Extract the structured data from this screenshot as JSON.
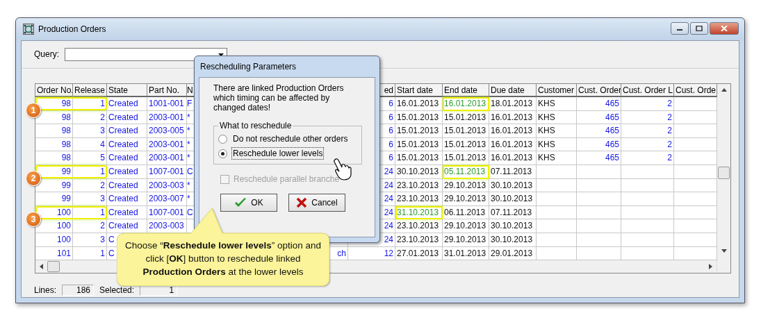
{
  "window": {
    "title": "Production Orders"
  },
  "query": {
    "label": "Query:"
  },
  "table": {
    "columns": [
      {
        "label": "Order No."
      },
      {
        "label": "Release"
      },
      {
        "label": "State"
      },
      {
        "label": "Part No."
      },
      {
        "label": "N"
      },
      {},
      {
        "label": "ed"
      },
      {
        "label": "Start date"
      },
      {
        "label": "End date"
      },
      {
        "label": "Due date"
      },
      {
        "label": "Customer"
      },
      {
        "label": "Cust. Order"
      },
      {
        "label": "Cust. Order L"
      },
      {
        "label": "Cust. Orde"
      }
    ],
    "rows": [
      {
        "step": "1",
        "cells": [
          {
            "text": "98",
            "highlighted": false
          },
          {
            "text": "1",
            "highlighted": false
          },
          {
            "text": "Created",
            "highlighted": false
          },
          {
            "text": "1001-001",
            "highlighted": false
          },
          {
            "text": "F",
            "highlighted": false
          },
          null,
          {
            "text": "6",
            "highlighted": false
          },
          {
            "text": "16.01.2013",
            "highlighted": false
          },
          {
            "text": "16.01.2013",
            "highlighted": true
          },
          {
            "text": "18.01.2013",
            "highlighted": false
          },
          {
            "text": "KHS",
            "highlighted": false
          },
          {
            "text": "465",
            "highlighted": false
          },
          {
            "text": "2",
            "highlighted": false
          },
          null
        ]
      },
      {
        "cells": [
          {
            "text": "98",
            "highlighted": false
          },
          {
            "text": "2",
            "highlighted": false
          },
          {
            "text": "Created",
            "highlighted": false
          },
          {
            "text": "2003-001",
            "highlighted": false
          },
          {
            "text": "*",
            "highlighted": false
          },
          null,
          {
            "text": "6",
            "highlighted": false
          },
          {
            "text": "15.01.2013",
            "highlighted": false
          },
          {
            "text": "15.01.2013",
            "highlighted": false
          },
          {
            "text": "16.01.2013",
            "highlighted": false
          },
          {
            "text": "KHS",
            "highlighted": false
          },
          {
            "text": "465",
            "highlighted": false
          },
          {
            "text": "2",
            "highlighted": false
          },
          null
        ]
      },
      {
        "cells": [
          {
            "text": "98",
            "highlighted": false
          },
          {
            "text": "3",
            "highlighted": false
          },
          {
            "text": "Created",
            "highlighted": false
          },
          {
            "text": "2003-005",
            "highlighted": false
          },
          {
            "text": "*",
            "highlighted": false
          },
          null,
          {
            "text": "6",
            "highlighted": false
          },
          {
            "text": "15.01.2013",
            "highlighted": false
          },
          {
            "text": "15.01.2013",
            "highlighted": false
          },
          {
            "text": "16.01.2013",
            "highlighted": false
          },
          {
            "text": "KHS",
            "highlighted": false
          },
          {
            "text": "465",
            "highlighted": false
          },
          {
            "text": "2",
            "highlighted": false
          },
          null
        ]
      },
      {
        "cells": [
          {
            "text": "98",
            "highlighted": false
          },
          {
            "text": "4",
            "highlighted": false
          },
          {
            "text": "Created",
            "highlighted": false
          },
          {
            "text": "2003-001",
            "highlighted": false
          },
          {
            "text": "*",
            "highlighted": false
          },
          null,
          {
            "text": "6",
            "highlighted": false
          },
          {
            "text": "15.01.2013",
            "highlighted": false
          },
          {
            "text": "15.01.2013",
            "highlighted": false
          },
          {
            "text": "16.01.2013",
            "highlighted": false
          },
          {
            "text": "KHS",
            "highlighted": false
          },
          {
            "text": "465",
            "highlighted": false
          },
          {
            "text": "2",
            "highlighted": false
          },
          null
        ]
      },
      {
        "cells": [
          {
            "text": "98",
            "highlighted": false
          },
          {
            "text": "5",
            "highlighted": false
          },
          {
            "text": "Created",
            "highlighted": false
          },
          {
            "text": "2003-001",
            "highlighted": false
          },
          {
            "text": "*",
            "highlighted": false
          },
          null,
          {
            "text": "6",
            "highlighted": false
          },
          {
            "text": "15.01.2013",
            "highlighted": false
          },
          {
            "text": "15.01.2013",
            "highlighted": false
          },
          {
            "text": "16.01.2013",
            "highlighted": false
          },
          {
            "text": "KHS",
            "highlighted": false
          },
          {
            "text": "465",
            "highlighted": false
          },
          {
            "text": "2",
            "highlighted": false
          },
          null
        ]
      },
      {
        "step": "2",
        "cells": [
          {
            "text": "99",
            "highlighted": false
          },
          {
            "text": "1",
            "highlighted": false
          },
          {
            "text": "Created",
            "highlighted": false
          },
          {
            "text": "1007-001",
            "highlighted": false
          },
          {
            "text": "C",
            "highlighted": false
          },
          null,
          {
            "text": "24",
            "highlighted": false
          },
          {
            "text": "30.10.2013",
            "highlighted": false
          },
          {
            "text": "05.11.2013",
            "highlighted": true
          },
          {
            "text": "07.11.2013",
            "highlighted": false
          },
          null,
          null,
          null,
          null
        ]
      },
      {
        "cells": [
          {
            "text": "99",
            "highlighted": false
          },
          {
            "text": "2",
            "highlighted": false
          },
          {
            "text": "Created",
            "highlighted": false
          },
          {
            "text": "2003-003",
            "highlighted": false
          },
          {
            "text": "*",
            "highlighted": false
          },
          null,
          {
            "text": "24",
            "highlighted": false
          },
          {
            "text": "23.10.2013",
            "highlighted": false
          },
          {
            "text": "29.10.2013",
            "highlighted": false
          },
          {
            "text": "30.10.2013",
            "highlighted": false
          },
          null,
          null,
          null,
          null
        ]
      },
      {
        "cells": [
          {
            "text": "99",
            "highlighted": false
          },
          {
            "text": "3",
            "highlighted": false
          },
          {
            "text": "Created",
            "highlighted": false
          },
          {
            "text": "2003-007",
            "highlighted": false
          },
          {
            "text": "*",
            "highlighted": false
          },
          null,
          {
            "text": "24",
            "highlighted": false
          },
          {
            "text": "23.10.2013",
            "highlighted": false
          },
          {
            "text": "29.10.2013",
            "highlighted": false
          },
          {
            "text": "30.10.2013",
            "highlighted": false
          },
          null,
          null,
          null,
          null
        ]
      },
      {
        "step": "3",
        "cells": [
          {
            "text": "100",
            "highlighted": false
          },
          {
            "text": "1",
            "highlighted": false
          },
          {
            "text": "Created",
            "highlighted": false
          },
          {
            "text": "1007-001",
            "highlighted": false
          },
          {
            "text": "C",
            "highlighted": false
          },
          null,
          {
            "text": "24",
            "highlighted": false
          },
          {
            "text": "31.10.2013",
            "highlighted": true
          },
          {
            "text": "06.11.2013",
            "highlighted": false
          },
          {
            "text": "07.11.2013",
            "highlighted": false
          },
          null,
          null,
          null,
          null
        ]
      },
      {
        "cells": [
          {
            "text": "100",
            "highlighted": false
          },
          {
            "text": "2",
            "highlighted": false
          },
          {
            "text": "Created",
            "highlighted": false
          },
          {
            "text": "2003-003",
            "highlighted": false
          },
          null,
          null,
          {
            "text": "24",
            "highlighted": false
          },
          {
            "text": "23.10.2013",
            "highlighted": false
          },
          {
            "text": "29.10.2013",
            "highlighted": false
          },
          {
            "text": "30.10.2013",
            "highlighted": false
          },
          null,
          null,
          null,
          null
        ]
      },
      {
        "cells": [
          {
            "text": "100",
            "highlighted": false
          },
          {
            "text": "3",
            "highlighted": false
          },
          {
            "text": "C",
            "highlighted": false
          },
          null,
          null,
          null,
          {
            "text": "24",
            "highlighted": false
          },
          {
            "text": "23.10.2013",
            "highlighted": false
          },
          {
            "text": "29.10.2013",
            "highlighted": false
          },
          {
            "text": "30.10.2013",
            "highlighted": false
          },
          null,
          null,
          null,
          null
        ]
      },
      {
        "cells": [
          {
            "text": "101",
            "highlighted": false
          },
          {
            "text": "1",
            "highlighted": false
          },
          {
            "text": "C",
            "highlighted": false
          },
          null,
          null,
          {
            "text": "ch",
            "highlighted": false
          },
          {
            "text": "12",
            "highlighted": false
          },
          {
            "text": "27.01.2013",
            "highlighted": false
          },
          {
            "text": "31.01.2013",
            "highlighted": false
          },
          {
            "text": "29.01.2013",
            "highlighted": false
          },
          null,
          null,
          null,
          null
        ]
      }
    ]
  },
  "status_bar": {
    "lines_label": "Lines:",
    "lines": "186",
    "selected_label": "Selected:",
    "selected": "1"
  },
  "dialog": {
    "title": "Rescheduling Parameters",
    "message": "There are linked Production Orders which timing can be affected by changed dates!",
    "group": {
      "label": "What to reschedule",
      "options": [
        {
          "label": "Do not reschedule other orders",
          "selected": false
        },
        {
          "label": "Reschedule lower levels",
          "selected": true
        }
      ]
    },
    "checkbox": {
      "label": "Reschedule parallel branche",
      "checked": false,
      "disabled": true
    },
    "buttons": [
      {
        "kind": "ok",
        "label": "OK"
      },
      {
        "kind": "cancel",
        "label": "Cancel"
      }
    ]
  },
  "callout": {
    "text": "Choose “**Reschedule lower levels**” option and click [**OK**] button to reschedule linked **Production Orders** at the lower levels"
  }
}
